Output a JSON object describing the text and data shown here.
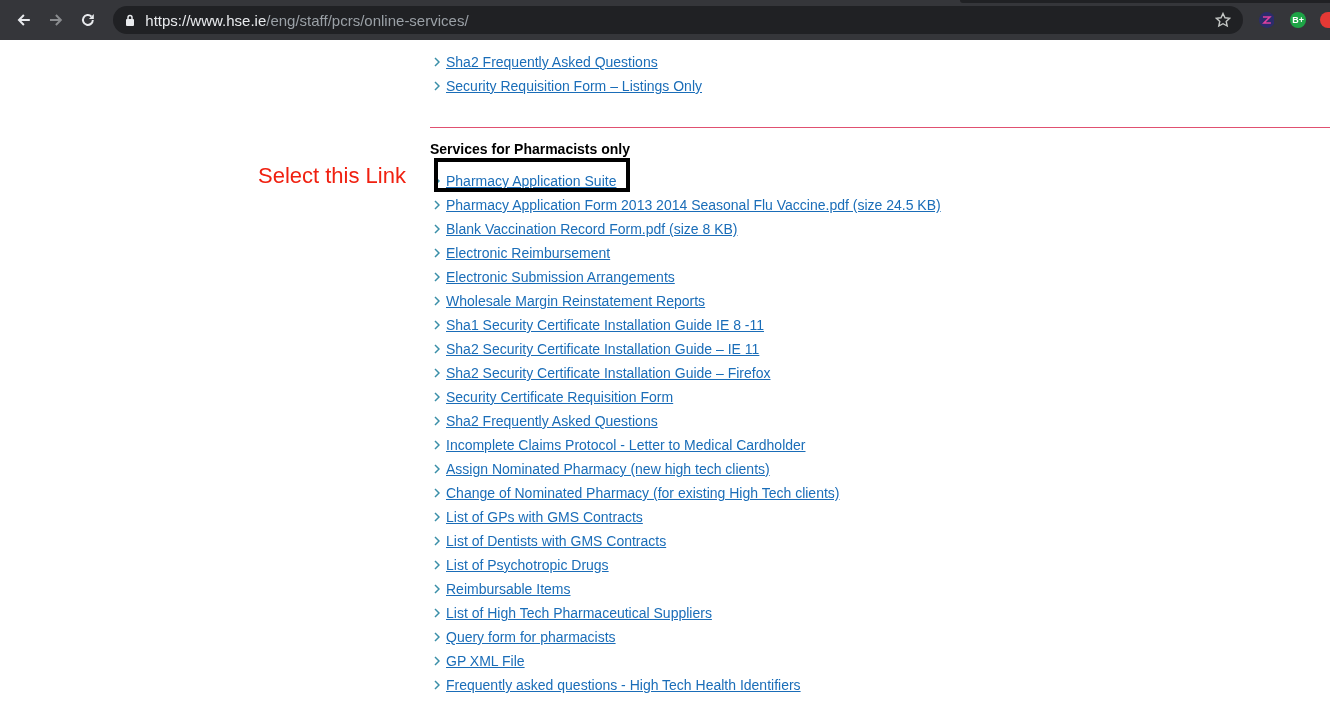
{
  "browser": {
    "url_host": "https://www.hse.ie",
    "url_path": "/eng/staff/pcrs/online-services/",
    "extension_badge": "B+"
  },
  "top_links": [
    {
      "label": "Sha2 Frequently Asked Questions"
    },
    {
      "label": "Security Requisition Form – Listings Only"
    }
  ],
  "section": {
    "heading": "Services for Pharmacists only",
    "annotation": "Select this Link",
    "links": [
      {
        "label": "Pharmacy Application Suite",
        "highlighted": true
      },
      {
        "label": "Pharmacy Application Form 2013 2014 Seasonal Flu Vaccine.pdf (size 24.5 KB)",
        "highlighted": false
      },
      {
        "label": "Blank Vaccination Record Form.pdf (size 8 KB)",
        "highlighted": false
      },
      {
        "label": "Electronic Reimbursement",
        "highlighted": false
      },
      {
        "label": "Electronic Submission Arrangements",
        "highlighted": false
      },
      {
        "label": "Wholesale Margin Reinstatement Reports",
        "highlighted": false
      },
      {
        "label": "Sha1 Security Certificate Installation Guide IE 8 -11",
        "highlighted": false
      },
      {
        "label": "Sha2 Security Certificate Installation Guide – IE 11",
        "highlighted": false
      },
      {
        "label": "Sha2 Security Certificate Installation Guide – Firefox",
        "highlighted": false
      },
      {
        "label": "Security Certificate Requisition Form",
        "highlighted": false
      },
      {
        "label": "Sha2 Frequently Asked Questions",
        "highlighted": false
      },
      {
        "label": "Incomplete Claims Protocol - Letter to Medical Cardholder",
        "highlighted": false
      },
      {
        "label": "Assign Nominated Pharmacy (new high tech clients)",
        "highlighted": false
      },
      {
        "label": "Change of Nominated Pharmacy (for existing High Tech clients)",
        "highlighted": false
      },
      {
        "label": "List of GPs with GMS Contracts",
        "highlighted": false
      },
      {
        "label": "List of Dentists with GMS Contracts",
        "highlighted": false
      },
      {
        "label": "List of Psychotropic Drugs",
        "highlighted": false
      },
      {
        "label": "Reimbursable Items",
        "highlighted": false
      },
      {
        "label": "List of High Tech Pharmaceutical Suppliers",
        "highlighted": false
      },
      {
        "label": "Query form for pharmacists",
        "highlighted": false
      },
      {
        "label": "GP XML File",
        "highlighted": false
      },
      {
        "label": "Frequently asked questions - High Tech Health Identifiers",
        "highlighted": false
      }
    ]
  }
}
